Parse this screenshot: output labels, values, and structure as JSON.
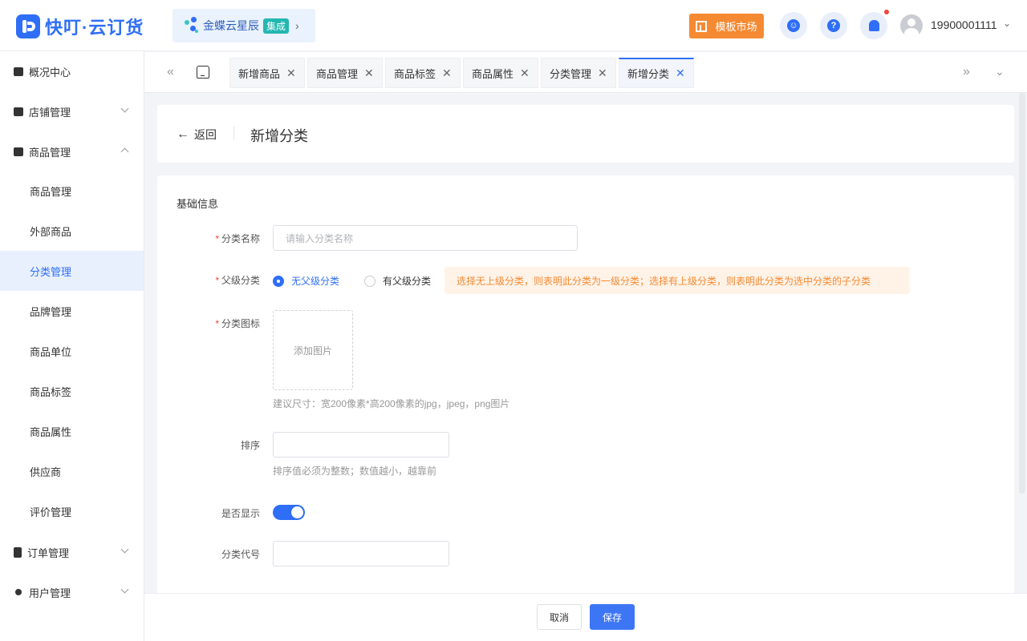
{
  "header": {
    "brand": "快叮·云订货",
    "integration": {
      "name": "金蝶云星辰",
      "badge": "集成"
    },
    "template_market": "模板市场",
    "user": "19900001111"
  },
  "sidebar": {
    "items": [
      {
        "label": "概况中心",
        "type": "group",
        "chevron": "none"
      },
      {
        "label": "店铺管理",
        "type": "group",
        "chevron": "down"
      },
      {
        "label": "商品管理",
        "type": "group",
        "chevron": "up"
      },
      {
        "label": "商品管理",
        "type": "sub"
      },
      {
        "label": "外部商品",
        "type": "sub"
      },
      {
        "label": "分类管理",
        "type": "sub",
        "active": true
      },
      {
        "label": "品牌管理",
        "type": "sub"
      },
      {
        "label": "商品单位",
        "type": "sub"
      },
      {
        "label": "商品标签",
        "type": "sub"
      },
      {
        "label": "商品属性",
        "type": "sub"
      },
      {
        "label": "供应商",
        "type": "sub"
      },
      {
        "label": "评价管理",
        "type": "sub"
      },
      {
        "label": "订单管理",
        "type": "group",
        "chevron": "down"
      },
      {
        "label": "用户管理",
        "type": "group",
        "chevron": "down"
      }
    ]
  },
  "tabs": [
    {
      "label": "新增商品"
    },
    {
      "label": "商品管理"
    },
    {
      "label": "商品标签"
    },
    {
      "label": "商品属性"
    },
    {
      "label": "分类管理"
    },
    {
      "label": "新增分类",
      "active": true
    }
  ],
  "page": {
    "back_label": "返回",
    "title": "新增分类"
  },
  "form": {
    "section_title": "基础信息",
    "name": {
      "label": "分类名称",
      "placeholder": "请输入分类名称",
      "value": ""
    },
    "parent": {
      "label": "父级分类",
      "option_none": "无父级分类",
      "option_has": "有父级分类",
      "selected": "无父级分类",
      "tip": "选择无上级分类，则表明此分类为一级分类；选择有上级分类，则表明此分类为选中分类的子分类"
    },
    "icon": {
      "label": "分类图标",
      "upload_text": "添加图片",
      "hint": "建议尺寸：宽200像素*高200像素的jpg，jpeg，png图片"
    },
    "sort": {
      "label": "排序",
      "value": "",
      "hint": "排序值必须为整数；数值越小，越靠前"
    },
    "visible": {
      "label": "是否显示",
      "on": true
    },
    "code": {
      "label": "分类代号",
      "value": ""
    }
  },
  "footer": {
    "cancel": "取消",
    "save": "保存"
  },
  "colors": {
    "primary": "#2f6ef6",
    "orange": "#f58a32",
    "warning_bg": "#fff3e8"
  }
}
